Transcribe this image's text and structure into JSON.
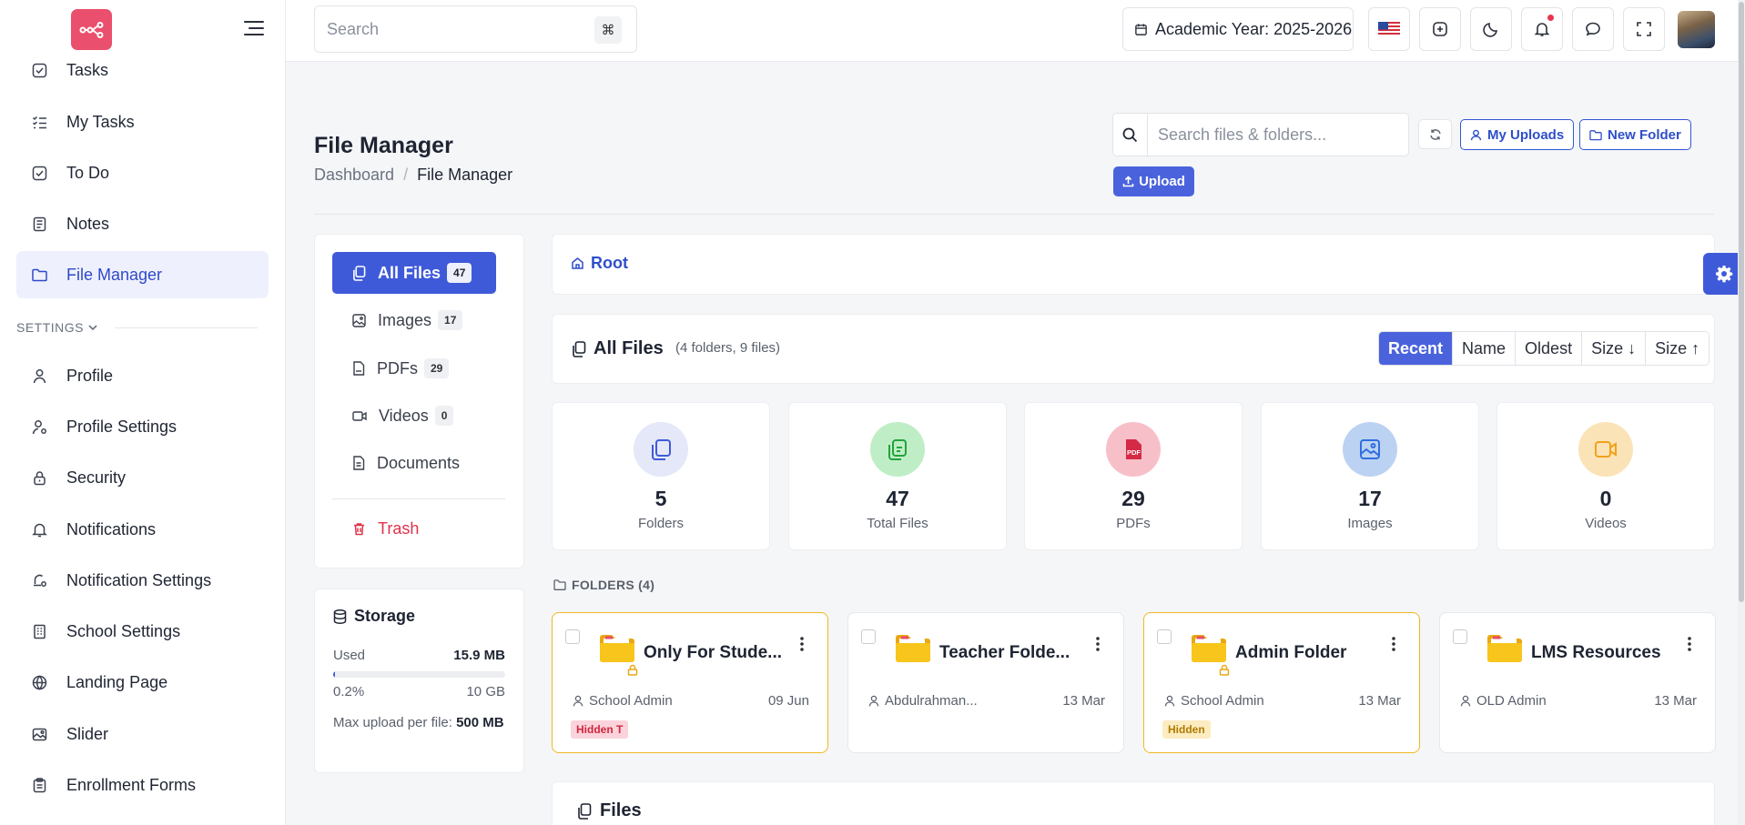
{
  "sidebar": {
    "items_top": [
      {
        "label": "Tasks",
        "icon": "check-square-icon"
      },
      {
        "label": "My Tasks",
        "icon": "list-check-icon"
      },
      {
        "label": "To Do",
        "icon": "check-square-icon"
      },
      {
        "label": "Notes",
        "icon": "notes-icon"
      },
      {
        "label": "File Manager",
        "icon": "folder-icon",
        "active": true
      }
    ],
    "section_title": "SETTINGS",
    "items_settings": [
      {
        "label": "Profile",
        "icon": "user-icon"
      },
      {
        "label": "Profile Settings",
        "icon": "user-cog-icon"
      },
      {
        "label": "Security",
        "icon": "lock-icon"
      },
      {
        "label": "Notifications",
        "icon": "bell-icon"
      },
      {
        "label": "Notification Settings",
        "icon": "bell-cog-icon"
      },
      {
        "label": "School Settings",
        "icon": "building-icon"
      },
      {
        "label": "Landing Page",
        "icon": "globe-icon"
      },
      {
        "label": "Slider",
        "icon": "image-icon"
      },
      {
        "label": "Enrollment Forms",
        "icon": "clipboard-icon"
      }
    ]
  },
  "topbar": {
    "search_placeholder": "Search",
    "search_shortcut": "⌘",
    "academic_year": "Academic Year: 2025-2026"
  },
  "page": {
    "title": "File Manager",
    "breadcrumb": [
      "Dashboard",
      "File Manager"
    ],
    "search_placeholder": "Search files & folders...",
    "my_uploads": "My Uploads",
    "new_folder": "New Folder",
    "upload": "Upload"
  },
  "categories": [
    {
      "label": "All Files",
      "count": "47",
      "active": true
    },
    {
      "label": "Images",
      "count": "17"
    },
    {
      "label": "PDFs",
      "count": "29"
    },
    {
      "label": "Videos",
      "count": "0"
    },
    {
      "label": "Documents",
      "count": ""
    }
  ],
  "trash_label": "Trash",
  "storage": {
    "title": "Storage",
    "used_label": "Used",
    "used_value": "15.9 MB",
    "percent": "0.2%",
    "percent_fraction": 0.002,
    "total": "10 GB",
    "max_upload_label": "Max upload per file:",
    "max_upload_value": "500 MB"
  },
  "root_label": "Root",
  "all_files": {
    "title": "All Files",
    "subtitle": "(4 folders, 9 files)",
    "sort": [
      "Recent",
      "Name",
      "Oldest",
      "Size ↓",
      "Size ↑"
    ],
    "sort_active": "Recent"
  },
  "stats": [
    {
      "value": "5",
      "label": "Folders",
      "color": "#3f5ad9",
      "bg": "#e4e8f8"
    },
    {
      "value": "47",
      "label": "Total Files",
      "color": "#22a33a",
      "bg": "#bfeec6"
    },
    {
      "value": "29",
      "label": "PDFs",
      "color": "#d42a45",
      "bg": "#f7c0c9"
    },
    {
      "value": "17",
      "label": "Images",
      "color": "#2f6fe0",
      "bg": "#bcd2f2"
    },
    {
      "value": "0",
      "label": "Videos",
      "color": "#f0a21a",
      "bg": "#fbe3b8"
    }
  ],
  "folders_label": "FOLDERS (4)",
  "folders": [
    {
      "name": "Only For Stude...",
      "owner": "School Admin",
      "date": "09 Jun",
      "tag": "Hidden T",
      "tag_style": "red",
      "locked": true,
      "highlight": true
    },
    {
      "name": "Teacher Folde...",
      "owner": "Abdulrahman...",
      "date": "13 Mar",
      "tag": "",
      "tag_style": "",
      "locked": false,
      "highlight": false
    },
    {
      "name": "Admin Folder",
      "owner": "School Admin",
      "date": "13 Mar",
      "tag": "Hidden",
      "tag_style": "yel",
      "locked": true,
      "highlight": true
    },
    {
      "name": "LMS Resources",
      "owner": "OLD Admin",
      "date": "13 Mar",
      "tag": "",
      "tag_style": "",
      "locked": false,
      "highlight": false
    }
  ],
  "files_title": "Files",
  "colors": {
    "accent": "#3f5ad9",
    "brand": "#ea4f6d",
    "folder": "#f8c51c",
    "warning": "#f2b822"
  }
}
